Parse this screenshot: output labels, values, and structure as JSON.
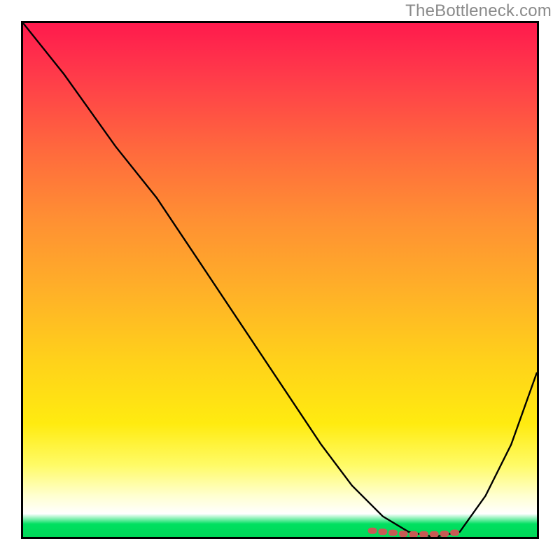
{
  "watermark": "TheBottleneck.com",
  "chart_data": {
    "type": "line",
    "title": "",
    "xlabel": "",
    "ylabel": "",
    "xlim": [
      0,
      100
    ],
    "ylim": [
      0,
      100
    ],
    "series": [
      {
        "name": "bottleneck-curve",
        "x": [
          0,
          8,
          18,
          26,
          34,
          42,
          50,
          58,
          64,
          70,
          75,
          80,
          85,
          90,
          95,
          100
        ],
        "values": [
          100,
          90,
          76,
          66,
          54,
          42,
          30,
          18,
          10,
          4,
          1,
          0,
          1,
          8,
          18,
          32
        ]
      }
    ],
    "markers": {
      "name": "highlight-range",
      "x": [
        68,
        70,
        72,
        74,
        76,
        78,
        80,
        82,
        84
      ],
      "values": [
        1.2,
        1.0,
        0.8,
        0.6,
        0.5,
        0.5,
        0.5,
        0.6,
        0.8
      ]
    },
    "gradient_stops": [
      {
        "pos": 0,
        "color": "#ff1a4d"
      },
      {
        "pos": 50,
        "color": "#ffb028"
      },
      {
        "pos": 80,
        "color": "#fff020"
      },
      {
        "pos": 96,
        "color": "#ffffff"
      },
      {
        "pos": 100,
        "color": "#00d858"
      }
    ]
  }
}
